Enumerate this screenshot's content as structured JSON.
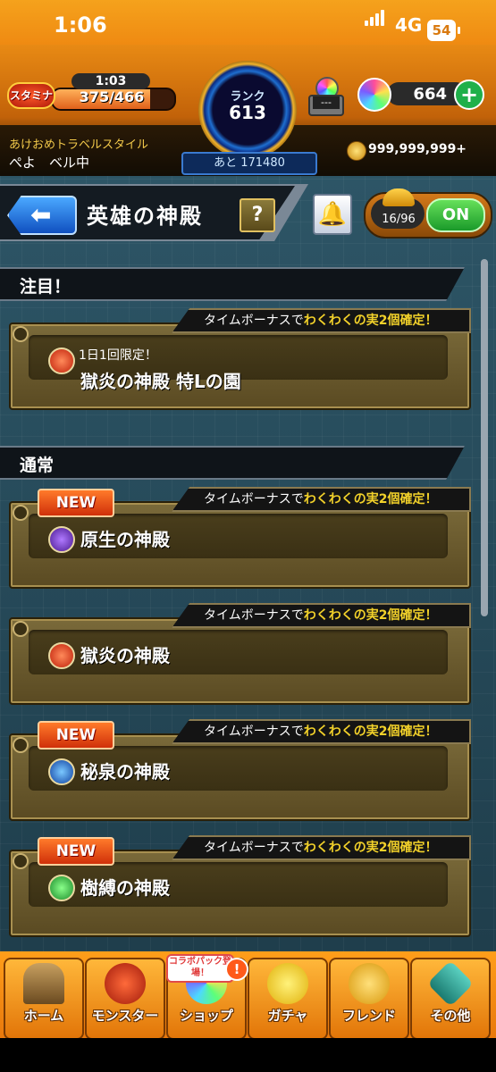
{
  "status_bar": {
    "time": "1:06",
    "network": "4G",
    "battery": "54"
  },
  "header": {
    "stamina_logo": "スタミナ",
    "stamina_timer": "1:03",
    "stamina_value": "375/466",
    "stamina_fraction": 0.805,
    "rank_label": "ランク",
    "rank_value": "613",
    "rank_next": "あと 171480",
    "machine_label": "---",
    "orb_count": "664",
    "add_orb": "+",
    "travel_style": "あけおめトラベルスタイル",
    "username": "ぺよ　ベル中",
    "coins": "999,999,999+"
  },
  "title_bar": {
    "back_arrow": "⬅",
    "title": "英雄の神殿",
    "help": "?",
    "bell": "🔔",
    "boost_count": "16/96",
    "toggle": "ON"
  },
  "sections": [
    {
      "label": "注目！"
    },
    {
      "label": "通常"
    }
  ],
  "bonus": {
    "prefix": "タイムボーナスで",
    "highlight": "わくわくの実2個確定！"
  },
  "cards": [
    {
      "new": "",
      "sub": "1日1回限定！",
      "name": "獄炎の神殿 特Lの園",
      "element": "fire"
    },
    {
      "new": "NEW",
      "sub": "",
      "name": "原生の神殿",
      "element": "dark"
    },
    {
      "new": "",
      "sub": "",
      "name": "獄炎の神殿",
      "element": "fire"
    },
    {
      "new": "NEW",
      "sub": "",
      "name": "秘泉の神殿",
      "element": "water"
    },
    {
      "new": "NEW",
      "sub": "",
      "name": "樹縛の神殿",
      "element": "wood"
    }
  ],
  "nav": {
    "collab_badge": "コラボパック登場！",
    "collab_alert": "!",
    "items": [
      {
        "label": "ホーム",
        "icon": "home-icon"
      },
      {
        "label": "モンスター",
        "icon": "monster-icon"
      },
      {
        "label": "ショップ",
        "icon": "shop-orb-icon"
      },
      {
        "label": "ガチャ",
        "icon": "gacha-icon"
      },
      {
        "label": "フレンド",
        "icon": "friend-icon"
      },
      {
        "label": "その他",
        "icon": "other-icon"
      }
    ]
  }
}
